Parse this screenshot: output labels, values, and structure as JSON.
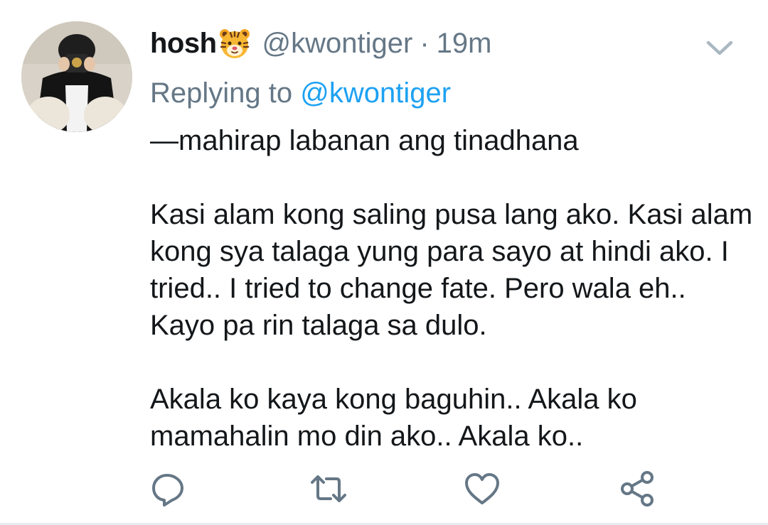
{
  "tweet": {
    "display_name": "hosh",
    "name_emoji": "tiger-face-emoji",
    "handle": "@kwontiger",
    "separator": "·",
    "time_ago": "19m",
    "reply_prefix": "Replying to",
    "reply_target": "@kwontiger",
    "paragraphs": [
      "—mahirap labanan ang tinadhana",
      "Kasi alam kong saling pusa lang ako. Kasi alam kong sya talaga yung para sayo at hindi ako. I tried.. I tried to change fate. Pero wala eh.. Kayo pa rin talaga sa dulo.",
      "Akala ko kaya kong baguhin.. Akala ko mamahalin mo din ako.. Akala ko.."
    ]
  },
  "actions": {
    "reply_icon": "reply-icon",
    "retweet_icon": "retweet-icon",
    "like_icon": "heart-icon",
    "share_icon": "share-icon"
  },
  "colors": {
    "text_primary": "#14171a",
    "text_secondary": "#657786",
    "link_blue": "#1da1f2",
    "icon_gray": "#657786"
  }
}
